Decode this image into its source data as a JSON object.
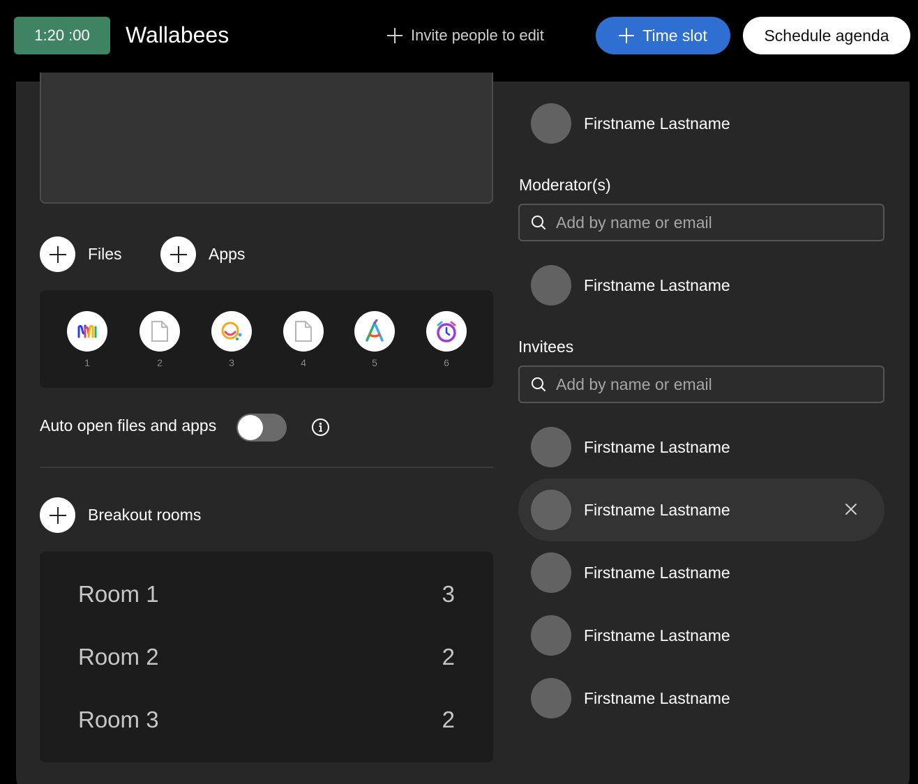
{
  "header": {
    "timer": "1:20 :00",
    "title": "Wallabees",
    "invite_label": "Invite people to edit",
    "time_slot_label": "Time slot",
    "schedule_label": "Schedule agenda"
  },
  "colors": {
    "timer_bg": "#3e8462",
    "primary": "#2f6fd2",
    "panel_bg": "#272727"
  },
  "content": {
    "files_label": "Files",
    "apps_label": "Apps",
    "attachments": [
      {
        "num": "1",
        "icon": "miro-icon"
      },
      {
        "num": "2",
        "icon": "file-icon"
      },
      {
        "num": "3",
        "icon": "smile-app-icon"
      },
      {
        "num": "4",
        "icon": "file-icon"
      },
      {
        "num": "5",
        "icon": "triangle-app-icon"
      },
      {
        "num": "6",
        "icon": "alarm-clock-icon"
      }
    ],
    "auto_open_label": "Auto open files and apps",
    "auto_open_enabled": false,
    "breakout_label": "Breakout rooms",
    "rooms": [
      {
        "name": "Room 1",
        "count": "3"
      },
      {
        "name": "Room 2",
        "count": "2"
      },
      {
        "name": "Room 3",
        "count": "2"
      }
    ]
  },
  "people": {
    "owner": "Firstname Lastname",
    "moderators_label": "Moderator(s)",
    "moderator_search_placeholder": "Add by name or email",
    "moderators": [
      "Firstname Lastname"
    ],
    "invitees_label": "Invitees",
    "invitee_search_placeholder": "Add by name or email",
    "invitees": [
      "Firstname Lastname",
      "Firstname Lastname",
      "Firstname Lastname",
      "Firstname Lastname",
      "Firstname Lastname"
    ]
  }
}
